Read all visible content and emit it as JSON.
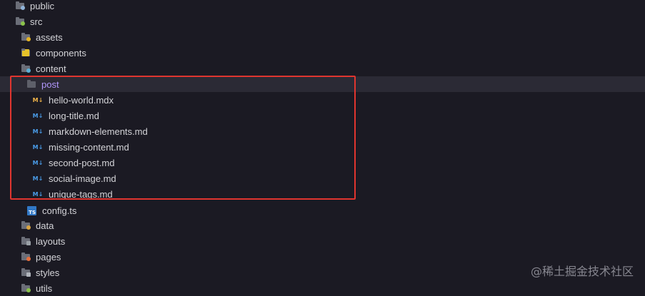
{
  "tree": {
    "items": [
      {
        "label": "public",
        "icon": "globe-folder-icon"
      },
      {
        "label": "src",
        "icon": "code-folder-icon"
      },
      {
        "label": "assets",
        "icon": "assets-folder-icon"
      },
      {
        "label": "components",
        "icon": "components-folder-icon"
      },
      {
        "label": "content",
        "icon": "content-folder-icon"
      },
      {
        "label": "post",
        "icon": "folder-open-icon",
        "selected": true
      },
      {
        "label": "hello-world.mdx",
        "icon": "mdx-file-icon"
      },
      {
        "label": "long-title.md",
        "icon": "markdown-file-icon"
      },
      {
        "label": "markdown-elements.md",
        "icon": "markdown-file-icon"
      },
      {
        "label": "missing-content.md",
        "icon": "markdown-file-icon"
      },
      {
        "label": "second-post.md",
        "icon": "markdown-file-icon"
      },
      {
        "label": "social-image.md",
        "icon": "markdown-file-icon"
      },
      {
        "label": "unique-tags.md",
        "icon": "markdown-file-icon"
      },
      {
        "label": "config.ts",
        "icon": "typescript-file-icon"
      },
      {
        "label": "data",
        "icon": "data-folder-icon"
      },
      {
        "label": "layouts",
        "icon": "layouts-folder-icon"
      },
      {
        "label": "pages",
        "icon": "pages-folder-icon"
      },
      {
        "label": "styles",
        "icon": "styles-folder-icon"
      },
      {
        "label": "utils",
        "icon": "utils-folder-icon"
      }
    ]
  },
  "icon_glyphs": {
    "markdown": "M↓",
    "typescript": "TS"
  },
  "colors": {
    "background": "#1b1a23",
    "selected_row": "#2b2a35",
    "selected_text": "#b197fc",
    "highlight_border": "#e0352f",
    "markdown_icon": "#4a9ce8",
    "mdx_icon": "#f0b449",
    "typescript_icon": "#3178c6"
  },
  "watermark": "@稀土掘金技术社区"
}
